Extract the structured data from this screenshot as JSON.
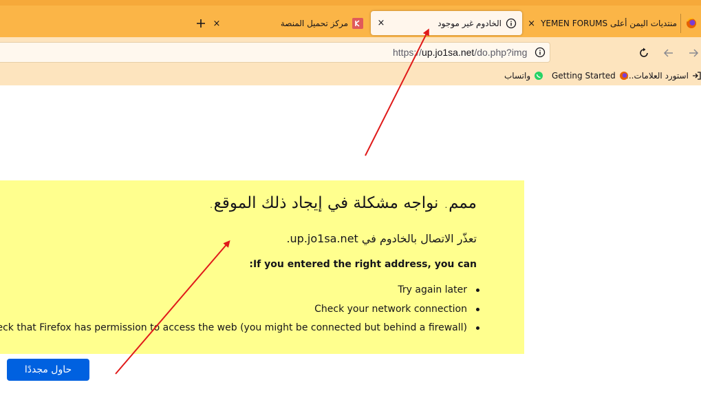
{
  "tabs": [
    {
      "title": "منتديات اليمن أعلى YEMEN FORUMS",
      "close": "×"
    },
    {
      "title": "الخادوم غير موجود",
      "close": "×",
      "active": true
    },
    {
      "title": "مركز تحميل المنصة",
      "close": "×"
    }
  ],
  "new_tab_icon": "plus-icon",
  "urlbar": {
    "scheme": "https://",
    "host": "up.jo1sa.net",
    "path": "/do.php?img"
  },
  "bookmarks": [
    {
      "label": "استورد العلامات...",
      "icon": "import-icon"
    },
    {
      "label": "Getting Started",
      "icon": "firefox-icon"
    },
    {
      "label": "واتساب",
      "icon": "whatsapp-icon"
    }
  ],
  "error": {
    "title": "ممم. نواجه مشكلة في إيجاد ذلك الموقع.",
    "subtitle": "تعذّر الاتصال بالخادوم في up.jo1sa.net.",
    "hint": "If you entered the right address, you can:",
    "items": [
      "Try again later",
      "Check your network connection",
      "Check that Firefox has permission to access the web (you might be connected but behind a firewall)"
    ],
    "retry_label": "حاول مجددًا"
  },
  "colors": {
    "tabbar": "#fbb547",
    "navbar": "#fde4be",
    "error_highlight": "#ffff8e",
    "primary_button": "#0061e0",
    "arrow": "#e01a1a"
  }
}
